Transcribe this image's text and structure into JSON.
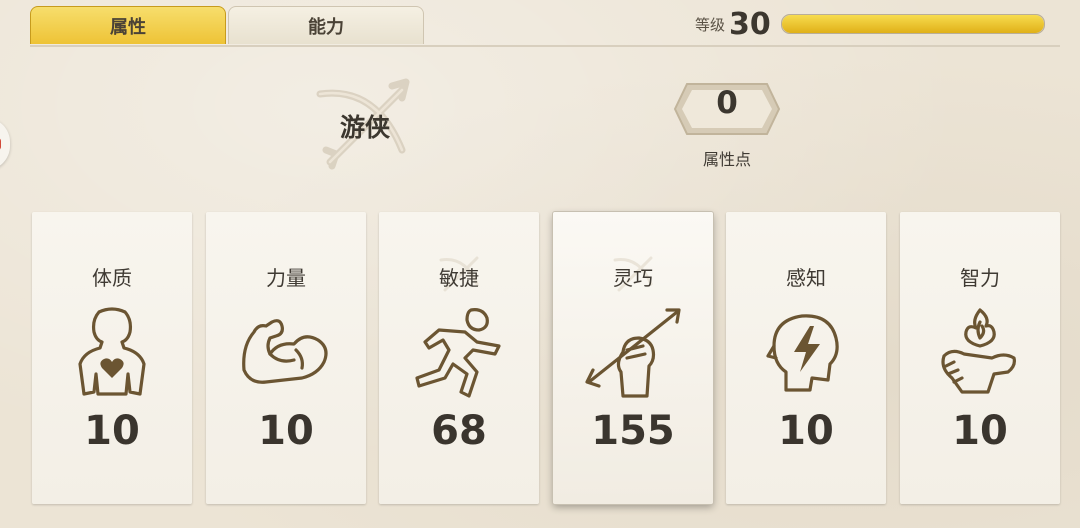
{
  "tabs": [
    {
      "label": "属性",
      "active": true
    },
    {
      "label": "能力",
      "active": false
    }
  ],
  "level": {
    "label": "等级",
    "value": "30",
    "progress": 1.0
  },
  "character_class": {
    "name": "游侠",
    "emblem_icon": "crossbow-emblem-icon"
  },
  "attribute_points": {
    "value": "0",
    "label": "属性点"
  },
  "stats": [
    {
      "label": "体质",
      "value": "10",
      "icon": "body-heart-icon"
    },
    {
      "label": "力量",
      "value": "10",
      "icon": "flexed-arm-icon"
    },
    {
      "label": "敏捷",
      "value": "68",
      "icon": "running-figure-icon"
    },
    {
      "label": "灵巧",
      "value": "155",
      "icon": "hand-arrow-icon",
      "selected": true
    },
    {
      "label": "感知",
      "value": "10",
      "icon": "head-lightning-icon"
    },
    {
      "label": "智力",
      "value": "10",
      "icon": "hand-flame-icon"
    }
  ],
  "colors": {
    "tab_active": "#f2cd45",
    "xp_fill": "#eec52e",
    "icon_stroke": "#6b5532",
    "background": "#ece4d5"
  }
}
